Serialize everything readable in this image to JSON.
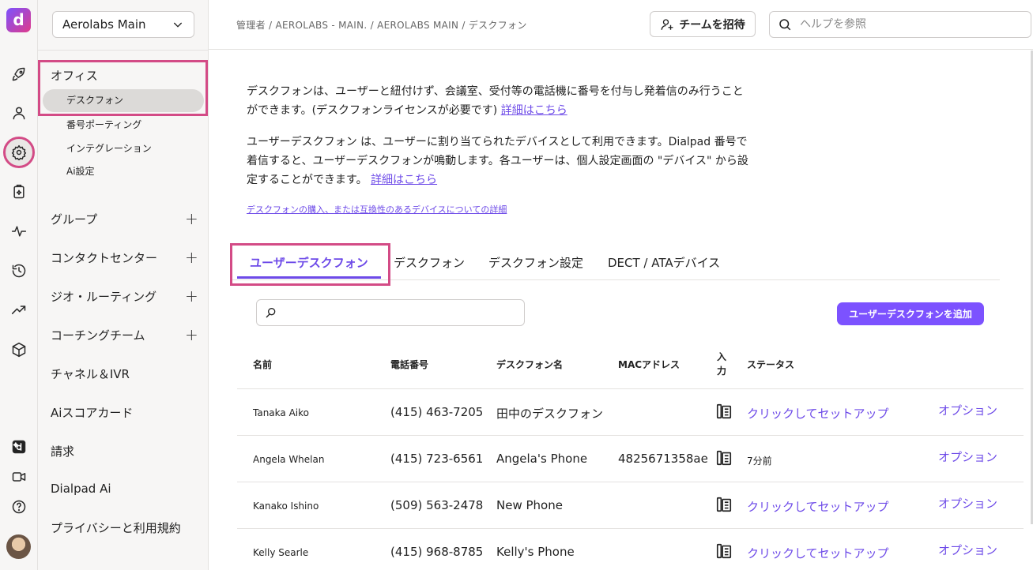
{
  "colors": {
    "accent": "#7c52ff",
    "highlight": "#d34b86",
    "link": "#6d4ae8"
  },
  "rail": {
    "logo_letter": "d",
    "icons": [
      "rocket-icon",
      "person-icon",
      "settings-gear-icon",
      "clipboard-sparkle-icon",
      "activity-pulse-icon",
      "history-icon",
      "trending-up-icon",
      "cube-icon",
      "dialpad-logo-icon",
      "video-icon",
      "help-icon"
    ]
  },
  "sidebar": {
    "workspace": "Aerolabs Main",
    "office": {
      "label": "オフィス",
      "items": [
        "デスクフォン",
        "番号ポーティング",
        "インテグレーション",
        "Ai設定"
      ]
    },
    "expandable": [
      "グループ",
      "コンタクトセンター",
      "ジオ・ルーティング",
      "コーチングチーム"
    ],
    "plain": [
      "チャネル＆IVR",
      "Aiスコアカード",
      "請求",
      "Dialpad Ai",
      "プライバシーと利用規約"
    ]
  },
  "topbar": {
    "breadcrumb": "管理者 / AEROLABS - MAIN. / AEROLABS MAIN / デスクフォン",
    "invite_label": "チームを招待",
    "help_placeholder": "ヘルプを参照"
  },
  "intro": {
    "p1": "デスクフォンは、ユーザーと紐付けず、会議室、受付等の電話機に番号を付与し発着信のみ行うことができます。(デスクフォンライセンスが必要です)",
    "p1_link": "詳細はこちら",
    "p2": "ユーザーデスクフォン は、ユーザーに割り当てられたデバイスとして利用できます。Dialpad 番号で着信すると、ユーザーデスクフォンが鳴動します。各ユーザーは、個人設定画面の \"デバイス\" から設定することができます。",
    "p2_link": "詳細はこちら",
    "purchase_link": "デスクフォンの購入、または互換性のあるデバイスについての詳細"
  },
  "tabs": [
    "ユーザーデスクフォン",
    "デスクフォン",
    "デスクフォン設定",
    "DECT / ATAデバイス"
  ],
  "table": {
    "search_value": "",
    "add_button": "ユーザーデスクフォンを追加",
    "headers": {
      "name": "名前",
      "phone": "電話番号",
      "desk_name": "デスクフォン名",
      "mac": "MACアドレス",
      "input": "入力",
      "status": "ステータス"
    },
    "rows": [
      {
        "name": "Tanaka Aiko",
        "phone": "(415) 463-7205",
        "desk_name": "田中のデスクフォン",
        "mac": "",
        "status": "クリックしてセットアップ",
        "status_type": "setup",
        "option": "オプション"
      },
      {
        "name": "Angela Whelan",
        "phone": "(415) 723-6561",
        "desk_name": "Angela's Phone",
        "mac": "4825671358ae",
        "status": "7分前",
        "status_type": "time",
        "option": "オプション"
      },
      {
        "name": "Kanako Ishino",
        "phone": "(509) 563-2478",
        "desk_name": "New Phone",
        "mac": "",
        "status": "クリックしてセットアップ",
        "status_type": "setup",
        "option": "オプション"
      },
      {
        "name": "Kelly Searle",
        "phone": "(415) 968-8785",
        "desk_name": "Kelly's Phone",
        "mac": "",
        "status": "クリックしてセットアップ",
        "status_type": "setup",
        "option": "オプション"
      }
    ]
  }
}
